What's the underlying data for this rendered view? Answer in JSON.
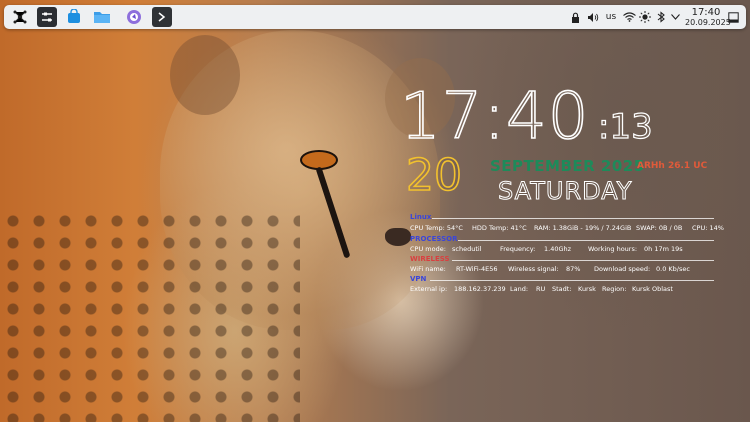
{
  "panel": {
    "launchers": [
      {
        "icon": "app-launcher-icon"
      },
      {
        "icon": "settings-sliders-icon"
      },
      {
        "icon": "discover-store-icon"
      },
      {
        "icon": "file-manager-icon"
      },
      {
        "icon": "browser-icon"
      },
      {
        "icon": "terminal-icon"
      }
    ],
    "tray": {
      "keyboard_layout": "us",
      "clock_time": "17:40",
      "clock_date": "20.09.2025"
    }
  },
  "conky": {
    "time_hm": "17:40",
    "time_sec": ":13",
    "day": "20",
    "month_year": "SEPTEMBER 2025",
    "location": "ARHh 26.1 UC",
    "weekday": "SATURDAY",
    "sections": {
      "system": {
        "title": "Linux",
        "cpu_temp": "CPU Temp: 54°C",
        "hdd_temp": "HDD Temp: 41°C",
        "ram": "RAM: 1.38GiB - 19% / 7.24GiB",
        "swap": "SWAP: 0B / 0B",
        "cpu": "CPU: 14%"
      },
      "processor": {
        "title": "PROCESSOR",
        "mode_label": "CPU mode:",
        "mode_value": "schedutil",
        "freq_label": "Frequency:",
        "freq_value": "1.40Ghz",
        "uptime_label": "Working hours:",
        "uptime_value": "0h 17m 19s"
      },
      "wireless": {
        "title": "WIRELESS",
        "name_label": "WiFi name:",
        "name_value": "RT-WiFi-4E56",
        "signal_label": "Wireless signal:",
        "signal_value": "87%",
        "speed_label": "Download speed:",
        "speed_value": "0.0 Kb/sec"
      },
      "vpn": {
        "title": "VPN",
        "ip_label": "External ip:",
        "ip_value": "188.162.37.239",
        "land_label": "Land:",
        "land_value": "RU",
        "stadt_label": "Stadt:",
        "stadt_value": "Kursk",
        "region_label": "Region:",
        "region_value": "Kursk Oblast"
      }
    }
  },
  "colors": {
    "panel_bg": "#eef0f2",
    "clock_outline": "#ffffff",
    "day_outline": "#f2c12e",
    "month_color": "#1e8a5a",
    "location_color": "#e05a3a",
    "linux_title": "#3b46d8",
    "processor_title": "#3b46d8",
    "wireless_title": "#d84040",
    "vpn_title": "#3b46d8"
  }
}
